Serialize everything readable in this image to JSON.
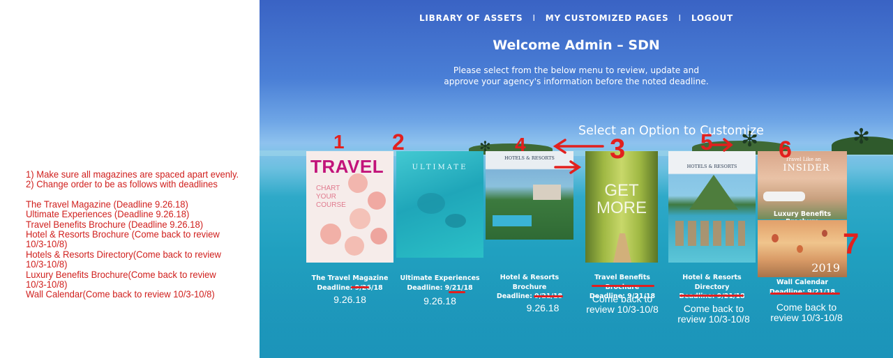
{
  "notes": {
    "line1": "1) Make sure all magazines are spaced apart evenly.",
    "line2": "2) Change order to be as follows with deadlines",
    "items": [
      "The Travel Magazine (Deadline 9.26.18)",
      "Ultimate Experiences (Deadline 9.26.18)",
      "Travel Benefits Brochure (Deadline 9.26.18)",
      "Hotel & Resorts Brochure (Come back to review",
      "10/3-10/8)",
      "Hotels & Resorts Directory(Come back to review",
      "10/3-10/8)",
      "Luxury Benefits Brochure(Come back to review",
      "10/3-10/8)",
      "Wall Calendar(Come back to review 10/3-10/8)"
    ]
  },
  "nav": {
    "library": "LIBRARY OF ASSETS",
    "sep": "I",
    "pages": "MY CUSTOMIZED PAGES",
    "logout": "LOGOUT"
  },
  "header": {
    "welcome": "Welcome Admin – SDN",
    "intro_line1": "Please select from the below menu to review, update and",
    "intro_line2": "approve your agency's information before the noted deadline.",
    "select_title": "Select an Option to Customize"
  },
  "covers": {
    "travel_title": "TRAVEL",
    "travel_tagline": "CHART YOUR COURSE",
    "ultimate_title": "ULTIMATE",
    "hotels_title": "HOTELS & RESORTS",
    "getmore_title": "GET MORE",
    "directory_title": "HOTELS & RESORTS",
    "insider_title": "INSIDER",
    "insider_top": "Travel Like an",
    "luxury_caption": "Luxury Benefits Brochure",
    "calendar_year": "2019"
  },
  "cards": [
    {
      "name": "The Travel Magazine",
      "deadline": "Deadline: 9/26/18",
      "handwritten": "9.26.18",
      "order_mark": "1"
    },
    {
      "name": "Ultimate Experiences",
      "deadline": "Deadline: 9/21/18",
      "handwritten": "9.26.18",
      "order_mark": "2"
    },
    {
      "name_line1": "Hotel & Resorts",
      "name_line2": "Brochure",
      "deadline": "Deadline: 9/21/18",
      "handwritten": "9.26.18",
      "order_mark": "4"
    },
    {
      "name": "Travel Benefits Brochure",
      "deadline": "Deadline: 9/21/18",
      "handwritten_line1": "Come back to",
      "handwritten_line2": "review 10/3-10/8",
      "order_mark": "3"
    },
    {
      "name_line1": "Hotel & Resorts",
      "name_line2": "Directory",
      "deadline": "Deadline: 9/21/18",
      "handwritten_line1": "Come back to",
      "handwritten_line2": "review 10/3-10/8",
      "order_mark": "5"
    },
    {
      "name": "Wall Calendar",
      "deadline": "Deadline: 9/21/18",
      "handwritten_line1": "Come back to",
      "handwritten_line2": "review 10/3-10/8",
      "order_mark": "6",
      "order_mark2": "7"
    }
  ],
  "colors": {
    "annotation_red": "#d0201e",
    "travel_pink": "#c2137a"
  }
}
